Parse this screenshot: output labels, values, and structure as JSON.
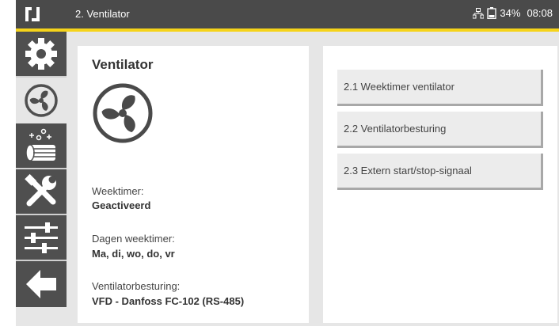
{
  "header": {
    "title": "2. Ventilator",
    "battery": "34%",
    "time": "08:08"
  },
  "sidebar": {
    "items": [
      {
        "icon": "gear-icon"
      },
      {
        "icon": "fan-icon",
        "active": true
      },
      {
        "icon": "heater-icon"
      },
      {
        "icon": "tools-icon"
      },
      {
        "icon": "sliders-icon"
      },
      {
        "icon": "back-arrow-icon"
      }
    ]
  },
  "left_panel": {
    "title": "Ventilator",
    "weektimer_label": "Weektimer:",
    "weektimer_value": "Geactiveerd",
    "days_label": "Dagen weektimer:",
    "days_value": "Ma, di, wo, do, vr",
    "control_label": "Ventilatorbesturing:",
    "control_value": "VFD - Danfoss FC-102 (RS-485)"
  },
  "menu": {
    "items": [
      {
        "label": "2.1 Weektimer ventilator"
      },
      {
        "label": "2.2 Ventilatorbesturing"
      },
      {
        "label": "2.3 Extern start/stop-signaal"
      }
    ]
  },
  "colors": {
    "topbar": "#4a4a4a",
    "accent": "#f5d31a",
    "sidebar_dark": "#4f4f4f",
    "background": "#e6e6e6"
  }
}
